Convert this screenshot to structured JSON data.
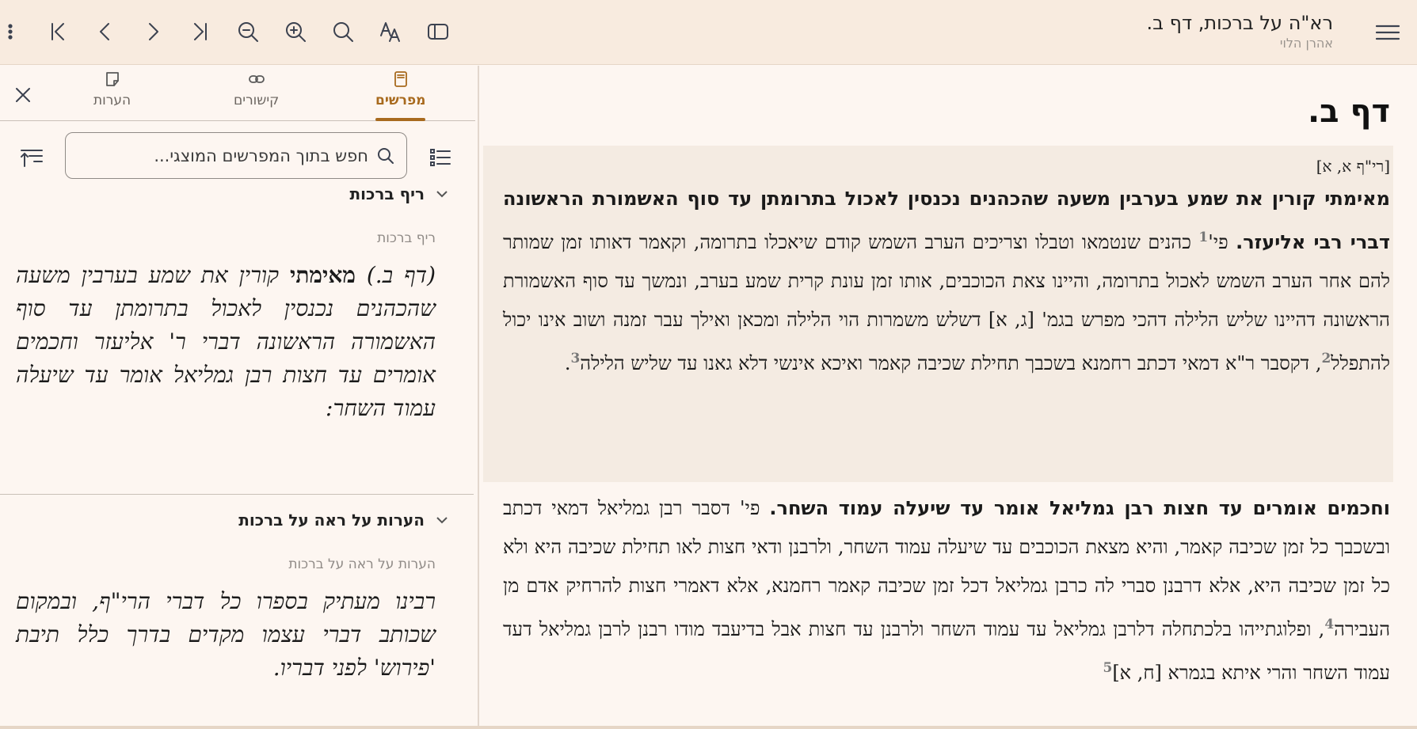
{
  "toolbar": {
    "title": "רא\"ה על ברכות, דף ב.",
    "subtitle": "אהרן הלוי",
    "buttons": [
      "more-icon",
      "first-page-icon",
      "previous-icon",
      "next-icon",
      "last-page-icon",
      "zoom-out-icon",
      "zoom-in-icon",
      "search-icon",
      "text-format-icon",
      "sidebar-toggle-icon",
      "hamburger-icon"
    ]
  },
  "tabs": [
    {
      "label": "מפרשים",
      "icon": "book-icon",
      "active": true
    },
    {
      "label": "קישורים",
      "icon": "link-icon",
      "active": false
    },
    {
      "label": "הערות",
      "icon": "note-icon",
      "active": false
    }
  ],
  "search": {
    "placeholder": "חפש בתוך המפרשים המוצגי..."
  },
  "sections": [
    {
      "header": "ריף ברכות",
      "subheader": "ריף ברכות",
      "text_pre": "(דף ב.) ",
      "text_bold": "מאימתי",
      "text_post": " קורין את שמע בערבין משעה שהכהנים נכנסין לאכול בתרומתן עד סוף האשמורה הראשונה דברי ר' אליעזר וחכמים אומרים עד חצות רבן גמליאל אומר עד שיעלה עמוד השחר:"
    },
    {
      "header": "הערות על ראה על ברכות",
      "subheader": "הערות על ראה על ברכות",
      "text": "רבינו מעתיק בספרו כל דברי הרי\"ף, ובמקום שכותב דברי עצמו מקדים בדרך כלל תיבת 'פירוש' לפני דבריו."
    }
  ],
  "main": {
    "heading": "דף ב.",
    "ref": "[רי\"ף א, א]",
    "p1": {
      "bold": "מאימתי קורין את שמע בערבין משעה שהכהנים נכנסין לאכול בתרומתן עד סוף האשמורת הראשונה דברי רבי אליעזר.",
      "t1": " פי'",
      "n1": "1",
      "t2": " כהנים שנטמאו וטבלו וצריכים הערב השמש קודם שיאכלו בתרומה, וקאמר דאותו זמן שמותר להם אחר הערב השמש לאכול בתרומה, והיינו צאת הכוכבים, אותו זמן עונת קרית שמע בערב, ונמשך עד סוף האשמורת הראשונה דהיינו שליש הלילה דהכי מפרש בגמ' [ג, א] דשלש משמרות הוי הלילה ומכאן ואילך עבר זמנה ושוב אינו יכול להתפלל",
      "n2": "2",
      "t3": ", דקסבר ר\"א דמאי דכתב רחמנא בשכבך תחילת שכיבה קאמר ואיכא אינשי דלא גאנו עד שליש הלילה",
      "n3": "3",
      "t4": "."
    },
    "p2": {
      "bold": "וחכמים אומרים עד חצות רבן גמליאל אומר עד שיעלה עמוד השחר.",
      "t1": " פי' דסבר רבן גמליאל דמאי דכתב ובשכבך כל זמן שכיבה קאמר, והיא מצאת הכוכבים עד שיעלה עמוד השחר, ולרבנן ודאי חצות לאו תחילת שכיבה היא ולא כל זמן שכיבה היא, אלא דרבנן סברי לה כרבן גמליאל דכל זמן שכיבה קאמר רחמנא, אלא דאמרי חצות להרחיק אדם מן העבירה",
      "n4": "4",
      "t2": ", ופלוגתייהו בלכתחלה דלרבן גמליאל עד עמוד השחר ולרבנן עד חצות אבל בדיעבד מודו רבנן לרבן גמליאל דעד עמוד השחר והרי איתא בגמרא [ח, א]",
      "n5": "5"
    }
  }
}
